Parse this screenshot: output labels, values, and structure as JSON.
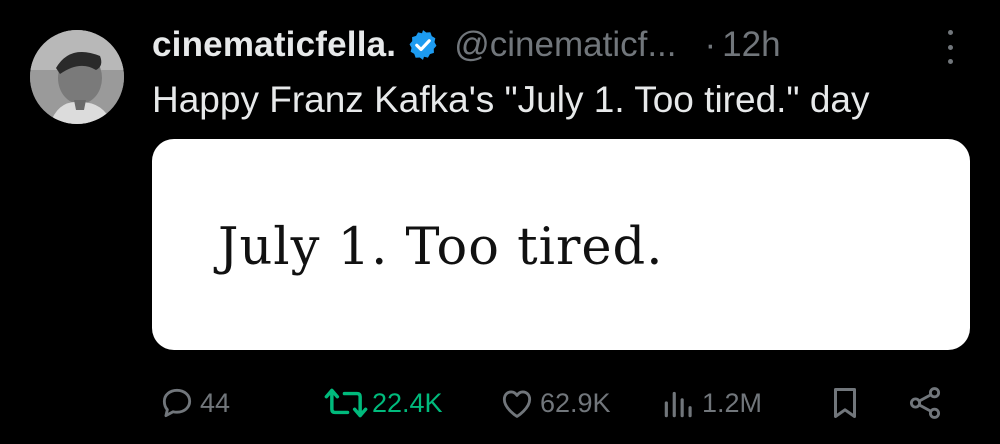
{
  "author": {
    "display_name": "cinematicfella.",
    "handle": "@cinematicf...",
    "separator": "·",
    "time": "12h",
    "verified_color": "#1d9bf0"
  },
  "tweet": {
    "text": "Happy Franz Kafka's \"July 1. Too tired.\" day",
    "media_text": "July 1. Too tired."
  },
  "actions": {
    "replies": "44",
    "retweets": "22.4K",
    "likes": "62.9K",
    "views": "1.2M",
    "retweet_color": "#00ba7c",
    "muted_color": "#71767b"
  },
  "icons": {
    "reply": "speech-bubble-icon",
    "retweet": "retweet-arrows-icon",
    "like": "heart-icon",
    "views": "bar-chart-icon",
    "bookmark": "bookmark-icon",
    "share": "share-nodes-icon",
    "more": "vertical-dots-icon",
    "verified": "verified-badge-icon"
  }
}
